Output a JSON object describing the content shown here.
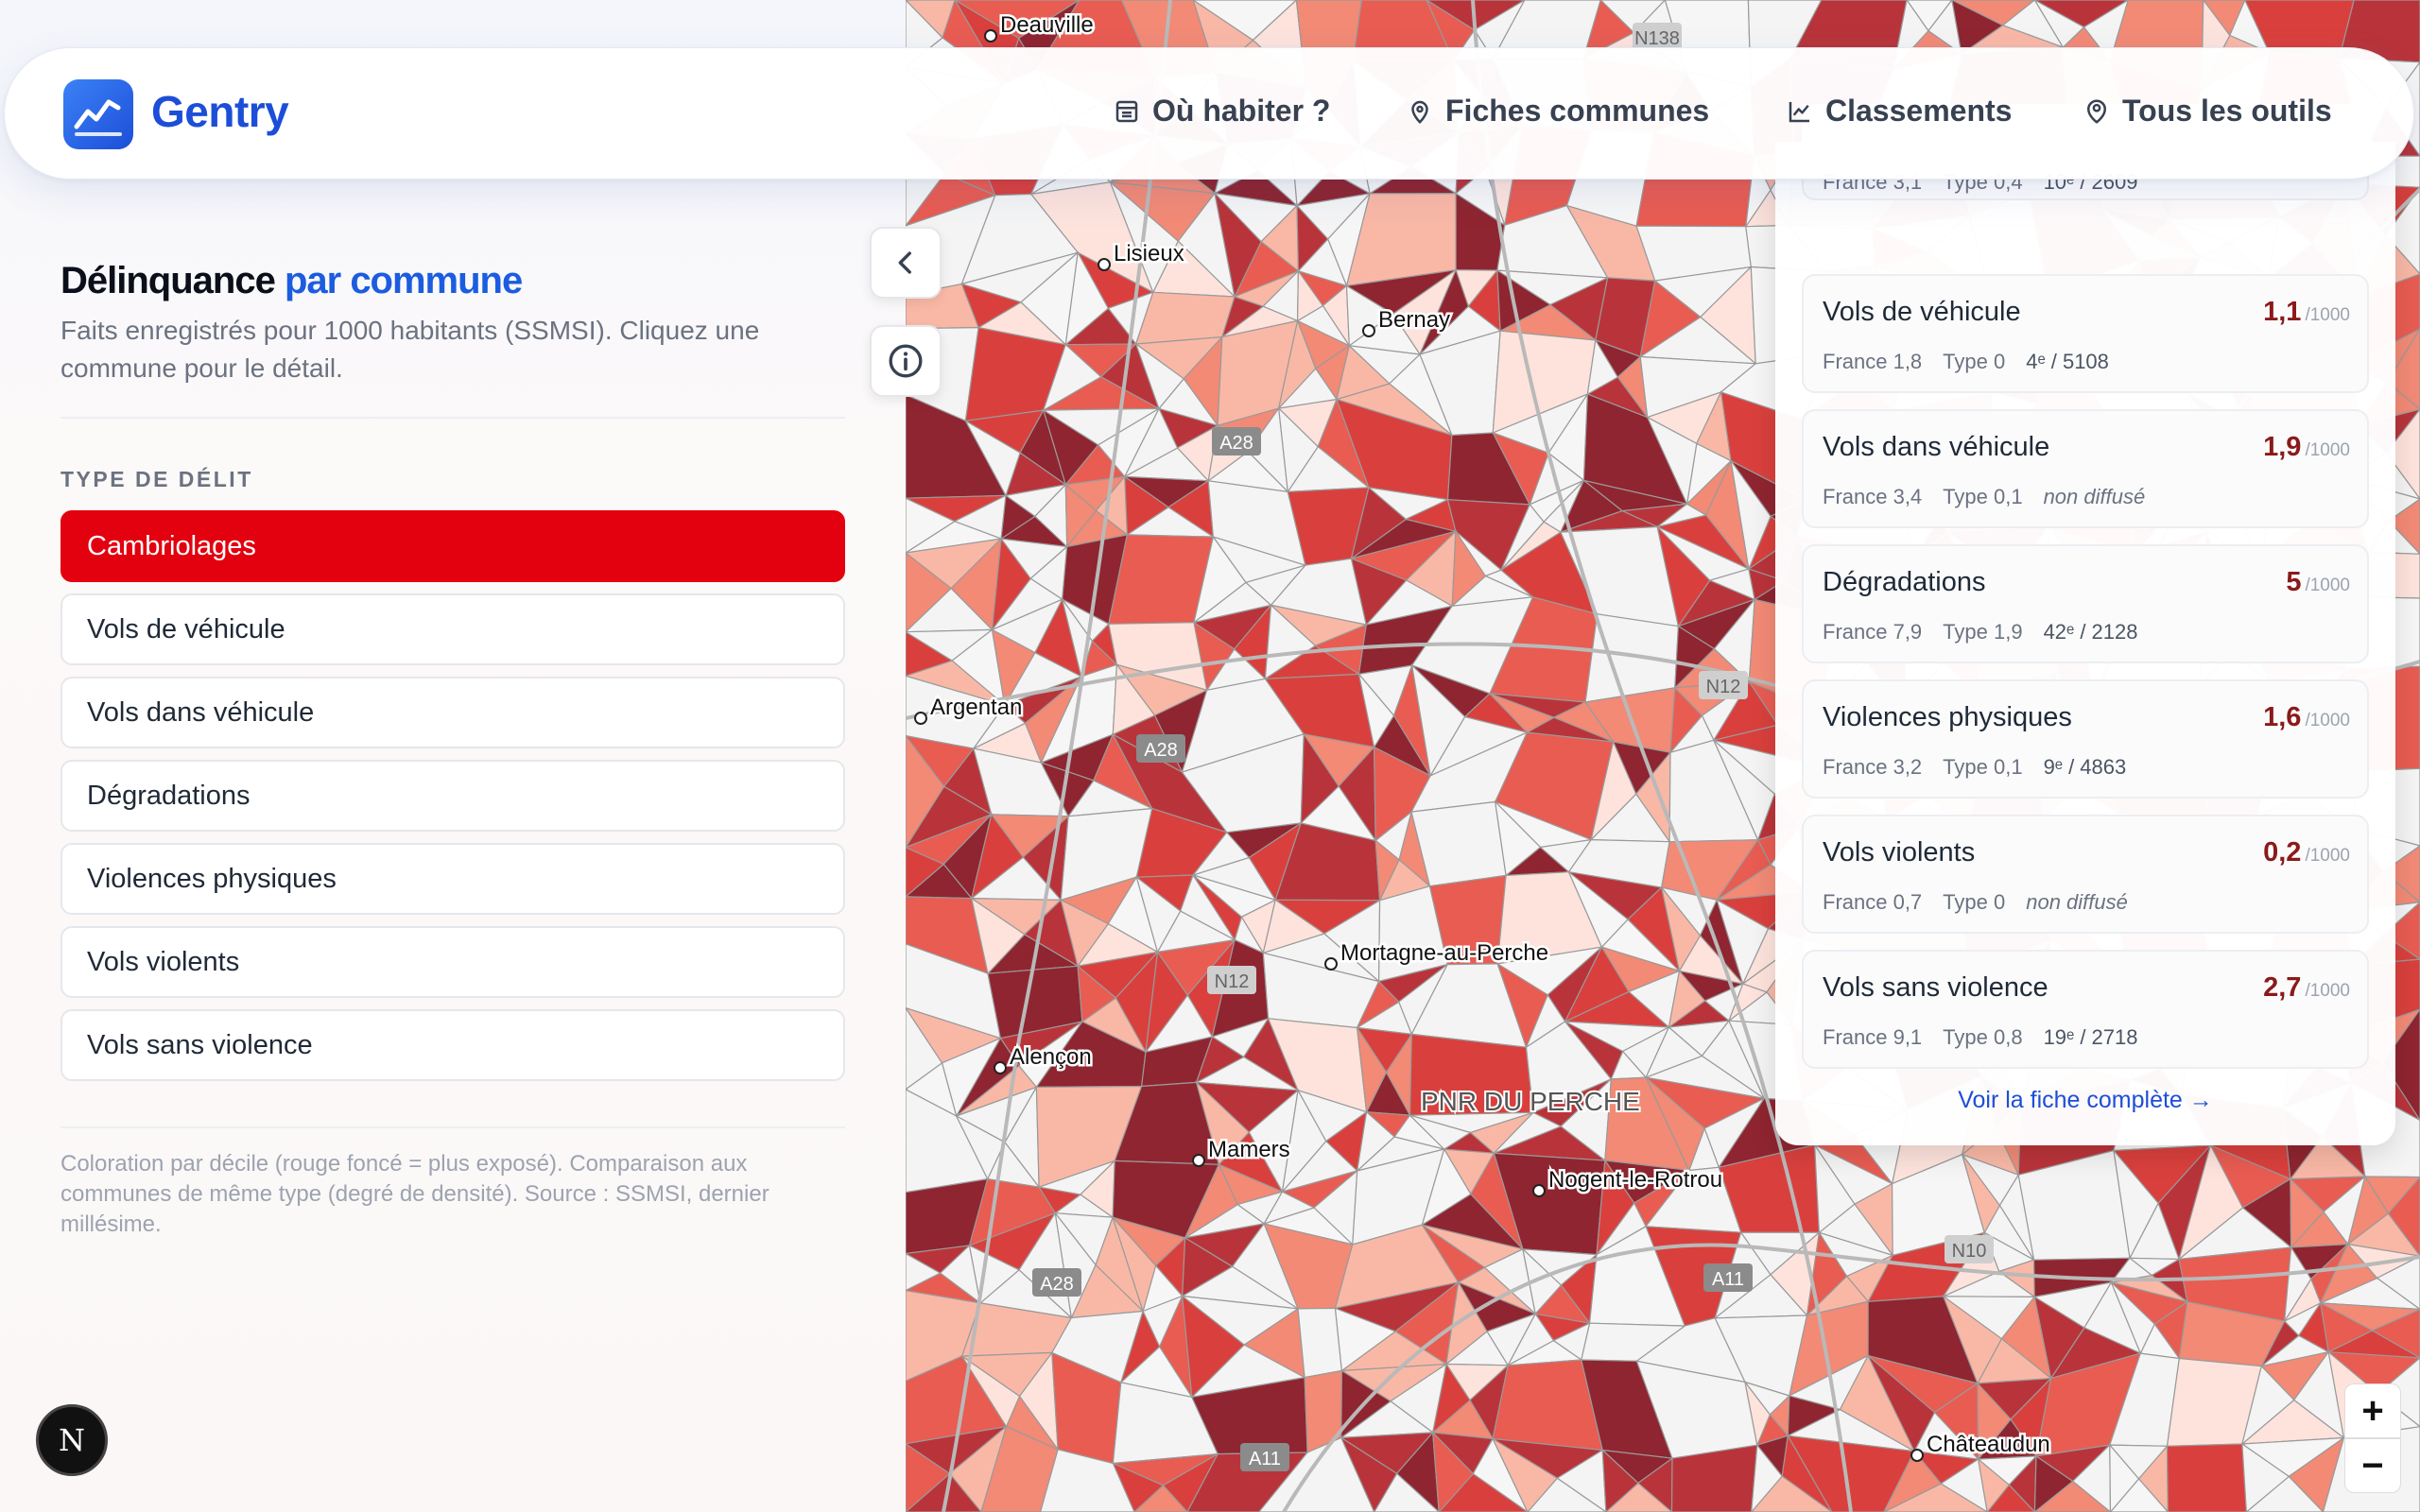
{
  "app": {
    "brand": "Gentry"
  },
  "nav": [
    {
      "label": "Où habiter ?",
      "icon": "building-icon"
    },
    {
      "label": "Fiches communes",
      "icon": "map-pin-icon"
    },
    {
      "label": "Classements",
      "icon": "chart-icon"
    },
    {
      "label": "Tous les outils",
      "icon": "user-pin-icon"
    }
  ],
  "panel": {
    "title_main": "Délinquance ",
    "title_accent": "par commune",
    "subtitle": "Faits enregistrés pour 1000 habitants (SSMSI). Cliquez une commune pour le détail.",
    "section_label": "TYPE DE DÉLIT",
    "crime_types": [
      "Cambriolages",
      "Vols de véhicule",
      "Vols dans véhicule",
      "Dégradations",
      "Violences physiques",
      "Vols violents",
      "Vols sans violence"
    ],
    "selected": "Cambriolages",
    "footnote": "Coloration par décile (rouge foncé = plus exposé). Comparaison aux communes de même type (degré de densité). Source : SSMSI, dernier millésime."
  },
  "detail": {
    "unit": "/1000",
    "partial_top": {
      "sub_france": "France 3,1",
      "sub_type": "Type 0,4",
      "rank": "10ᵉ / 2609"
    },
    "stats": [
      {
        "name": "Vols de véhicule",
        "value": "1,1",
        "france": "France 1,8",
        "type": "Type 0",
        "rank": "4ᵉ / 5108"
      },
      {
        "name": "Vols dans véhicule",
        "value": "1,9",
        "france": "France 3,4",
        "type": "Type 0,1",
        "rank": "non diffusé"
      },
      {
        "name": "Dégradations",
        "value": "5",
        "france": "France 7,9",
        "type": "Type 1,9",
        "rank": "42ᵉ / 2128"
      },
      {
        "name": "Violences physiques",
        "value": "1,6",
        "france": "France 3,2",
        "type": "Type 0,1",
        "rank": "9ᵉ / 4863"
      },
      {
        "name": "Vols violents",
        "value": "0,2",
        "france": "France 0,7",
        "type": "Type 0",
        "rank": "non diffusé"
      },
      {
        "name": "Vols sans violence",
        "value": "2,7",
        "france": "France 9,1",
        "type": "Type 0,8",
        "rank": "19ᵉ / 2718"
      }
    ],
    "more_link": "Voir la fiche complète →"
  },
  "map": {
    "cities": [
      "Lisieux",
      "Bernay",
      "Argentan",
      "Mortagne-au-Perche",
      "Alençon",
      "Mamers",
      "Nogent-le-Rotrou",
      "Châteaudun",
      "Deauville"
    ],
    "area_label": "PNR DU PERCHE",
    "roads": [
      "A28",
      "A28",
      "A28",
      "N12",
      "N12",
      "N10",
      "A11",
      "A11",
      "N138"
    ],
    "zoom_in": "+",
    "zoom_out": "−"
  },
  "badge": "N"
}
